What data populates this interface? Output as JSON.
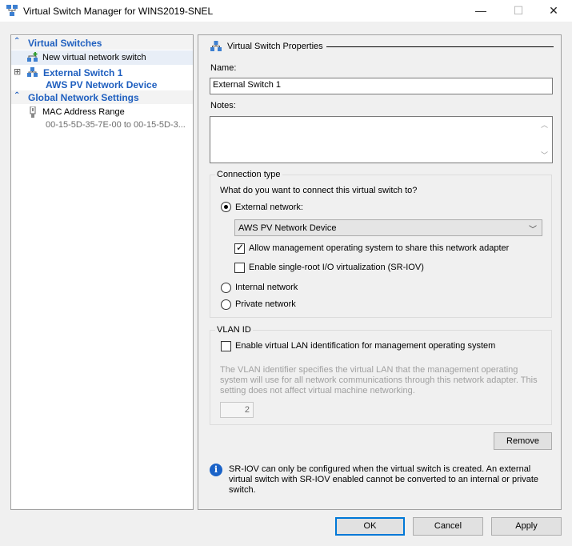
{
  "window": {
    "title": "Virtual Switch Manager for WINS2019-SNEL",
    "minimize_glyph": "—",
    "maximize_glyph": "☐",
    "close_glyph": "✕"
  },
  "left_pane": {
    "virtual_switches_header": "Virtual Switches",
    "new_switch_label": "New virtual network switch",
    "external_switch_name": "External Switch 1",
    "external_switch_device": "AWS PV Network Device",
    "expand_glyph": "⊞",
    "global_settings_header": "Global Network Settings",
    "mac_range_label": "MAC Address Range",
    "mac_range_value": "00-15-5D-35-7E-00 to 00-15-5D-3..."
  },
  "properties": {
    "section_title": "Virtual Switch Properties",
    "name_label": "Name:",
    "name_value": "External Switch 1",
    "notes_label": "Notes:",
    "notes_value": "",
    "connection_type": {
      "title": "Connection type",
      "question": "What do you want to connect this virtual switch to?",
      "external_label": "External network:",
      "external_selected": true,
      "adapter_selected": "AWS PV Network Device",
      "allow_mgmt_label": "Allow management operating system to share this network adapter",
      "allow_mgmt_checked": true,
      "sriov_label": "Enable single-root I/O virtualization (SR-IOV)",
      "sriov_checked": false,
      "internal_label": "Internal network",
      "private_label": "Private network"
    },
    "vlan": {
      "title": "VLAN ID",
      "enable_label": "Enable virtual LAN identification for management operating system",
      "enable_checked": false,
      "description": "The VLAN identifier specifies the virtual LAN that the management operating system will use for all network communications through this network adapter. This setting does not affect virtual machine networking.",
      "vlan_id_value": "2"
    },
    "remove_button": "Remove",
    "info_text": "SR-IOV can only be configured when the virtual switch is created. An external virtual switch with SR-IOV enabled cannot be converted to an internal or private switch."
  },
  "footer": {
    "ok_button": "OK",
    "cancel_button": "Cancel",
    "apply_button": "Apply"
  },
  "colors": {
    "accent": "#1f5fbf",
    "info_icon": "#1a63c8",
    "default_button_border": "#0078d7"
  }
}
